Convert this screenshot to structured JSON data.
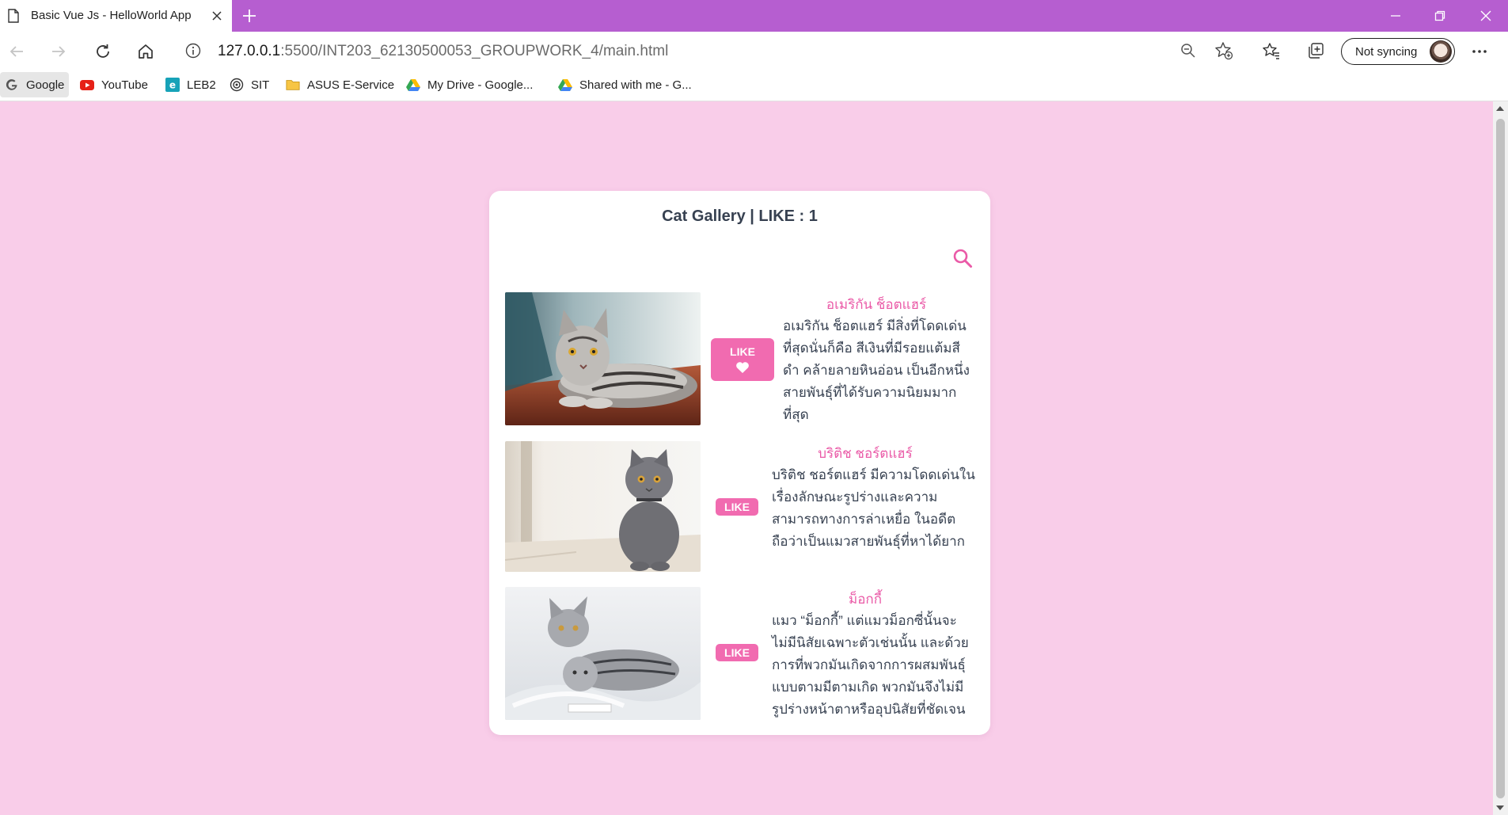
{
  "browser": {
    "tab_title": "Basic Vue Js - HelloWorld App",
    "url_host": "127.0.0.1",
    "url_rest": ":5500/INT203_62130500053_GROUPWORK_4/main.html",
    "sync_label": "Not syncing",
    "theme_color": "#b65ed0"
  },
  "bookmarks": [
    {
      "label": "Google",
      "icon": "google-icon"
    },
    {
      "label": "YouTube",
      "icon": "youtube-icon"
    },
    {
      "label": "LEB2",
      "icon": "leb2-icon"
    },
    {
      "label": "SIT",
      "icon": "sit-icon"
    },
    {
      "label": "ASUS E-Service",
      "icon": "folder-icon"
    },
    {
      "label": "My Drive - Google...",
      "icon": "google-drive-icon"
    },
    {
      "label": "Shared with me - G...",
      "icon": "google-drive-icon"
    }
  ],
  "gallery": {
    "title": "Cat Gallery | LIKE : 1",
    "accent_color": "#f16bb0",
    "background_color": "#f9cde9",
    "cats": [
      {
        "name": "อเมริกัน ช็อตแฮร์",
        "like_label": "LIKE",
        "liked": true,
        "description": "อเมริกัน ช็อตแฮร์ มีสิ่งที่โดดเด่นที่สุดนั่นก็คือ สีเงินที่มีรอยแต้มสีดำ คล้ายลายหินอ่อน เป็นอีกหนึ่งสายพันธุ์ที่ได้รับความนิยมมากที่สุด"
      },
      {
        "name": "บริติช ชอร์ตแฮร์",
        "like_label": "LIKE",
        "liked": false,
        "description": "บริติช ชอร์ตแฮร์ มีความโดดเด่นในเรื่องลักษณะรูปร่างและความสามารถทางการล่าเหยื่อ ในอดีตถือว่าเป็นแมวสายพันธุ์ที่หาได้ยาก"
      },
      {
        "name": "ม็อกกี้",
        "like_label": "LIKE",
        "liked": false,
        "description": "แมว “ม็อกกี้” แต่แมวม็อกซี่นั้นจะไม่มีนิสัยเฉพาะตัวเช่นนั้น และด้วยการที่พวกมันเกิดจากการผสมพันธุ์แบบตามมีตามเกิด พวกมันจึงไม่มีรูปร่างหน้าตาหรืออุปนิสัยที่ชัดเจน"
      }
    ]
  }
}
